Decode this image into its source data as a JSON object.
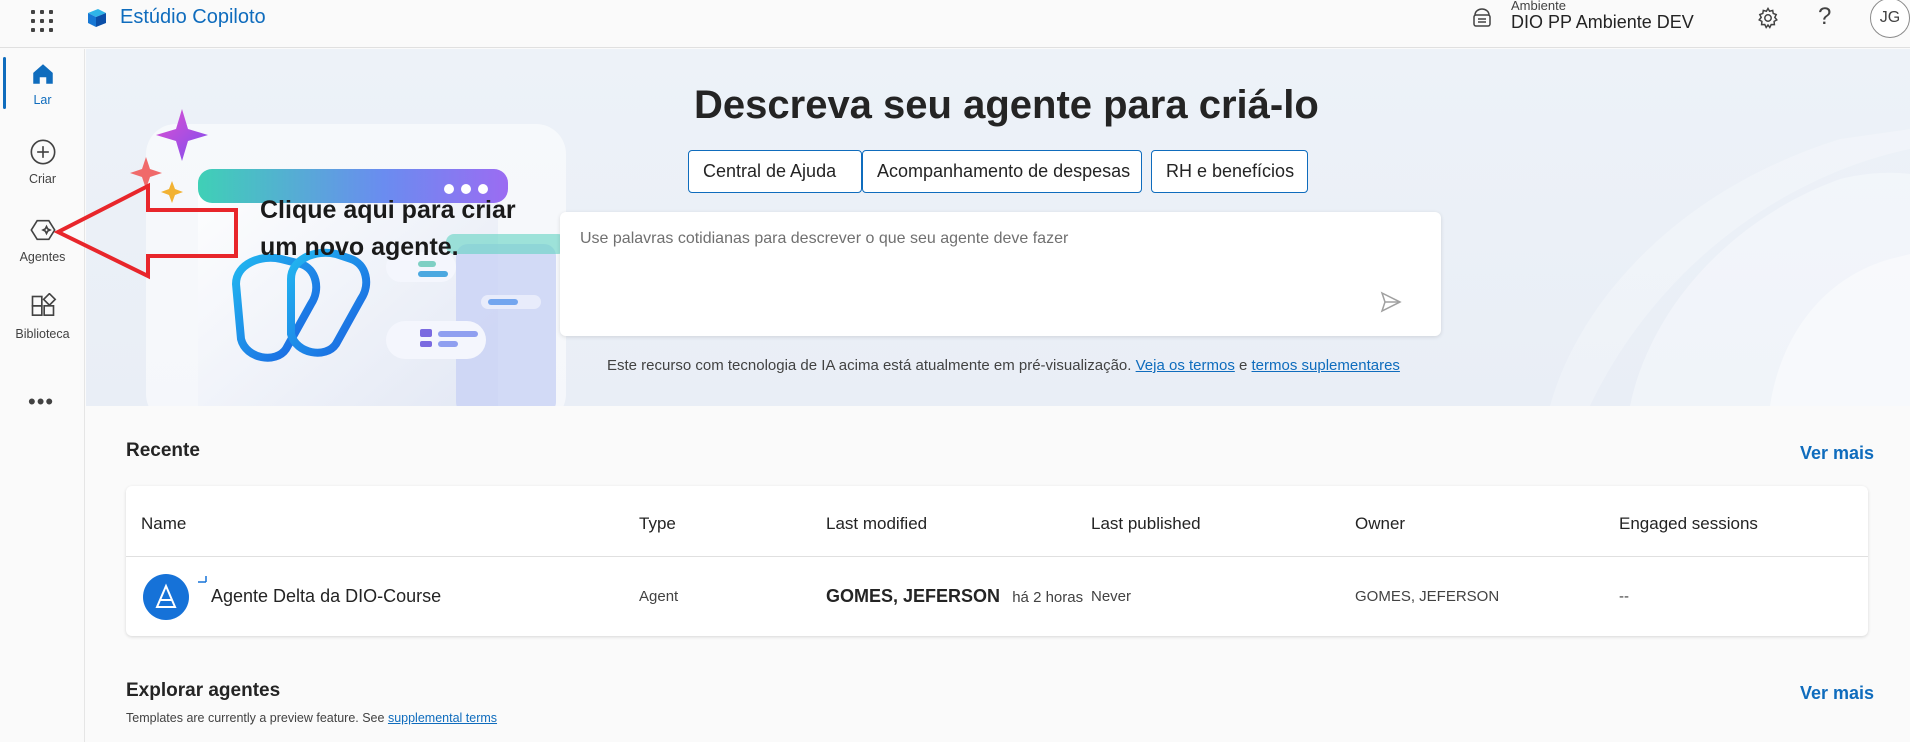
{
  "topbar": {
    "app_name": "Estúdio Copiloto",
    "environment_label": "Ambiente",
    "environment_name": "DIO PP Ambiente DEV",
    "help_glyph": "?",
    "avatar_initials": "JG"
  },
  "rail": {
    "items": [
      {
        "label": "Lar",
        "icon": "home-icon"
      },
      {
        "label": "Criar",
        "icon": "plus-circle-icon"
      },
      {
        "label": "Agentes",
        "icon": "agents-icon"
      },
      {
        "label": "Biblioteca",
        "icon": "library-icon"
      }
    ],
    "more": "•••"
  },
  "hero": {
    "title": "Descreva seu agente para criá-lo",
    "chips": [
      "Central de Ajuda",
      "Acompanhamento de despesas",
      "RH e benefícios"
    ],
    "prompt_placeholder": "Use palavras cotidianas para descrever o que seu agente deve fazer",
    "disclaimer_text": "Este recurso com tecnologia de IA acima está atualmente em pré-visualização.",
    "terms_link": "Veja os termos",
    "and_word": "e",
    "supplemental_link": "termos suplementares"
  },
  "annotation": {
    "line1": "Clique aqui para criar",
    "line2": "um novo agente.",
    "arrow_color": "#e8262b"
  },
  "recent": {
    "title": "Recente",
    "see_more": "Ver mais",
    "columns": [
      "Name",
      "Type",
      "Last modified",
      "Last published",
      "Owner",
      "Engaged sessions"
    ],
    "rows": [
      {
        "name": "Agente Delta da DIO-Course",
        "type": "Agent",
        "modified_by": "GOMES, JEFERSON",
        "modified_when": "há 2 horas",
        "published": "Never",
        "owner": "GOMES, JEFERSON",
        "sessions": "--"
      }
    ]
  },
  "explore": {
    "title": "Explorar agentes",
    "see_more": "Ver mais",
    "subtitle": "Templates are currently a preview feature. See",
    "subtitle_link": "supplemental terms"
  },
  "colors": {
    "accent": "#0f6cbd",
    "annotation_red": "#e8262b"
  }
}
